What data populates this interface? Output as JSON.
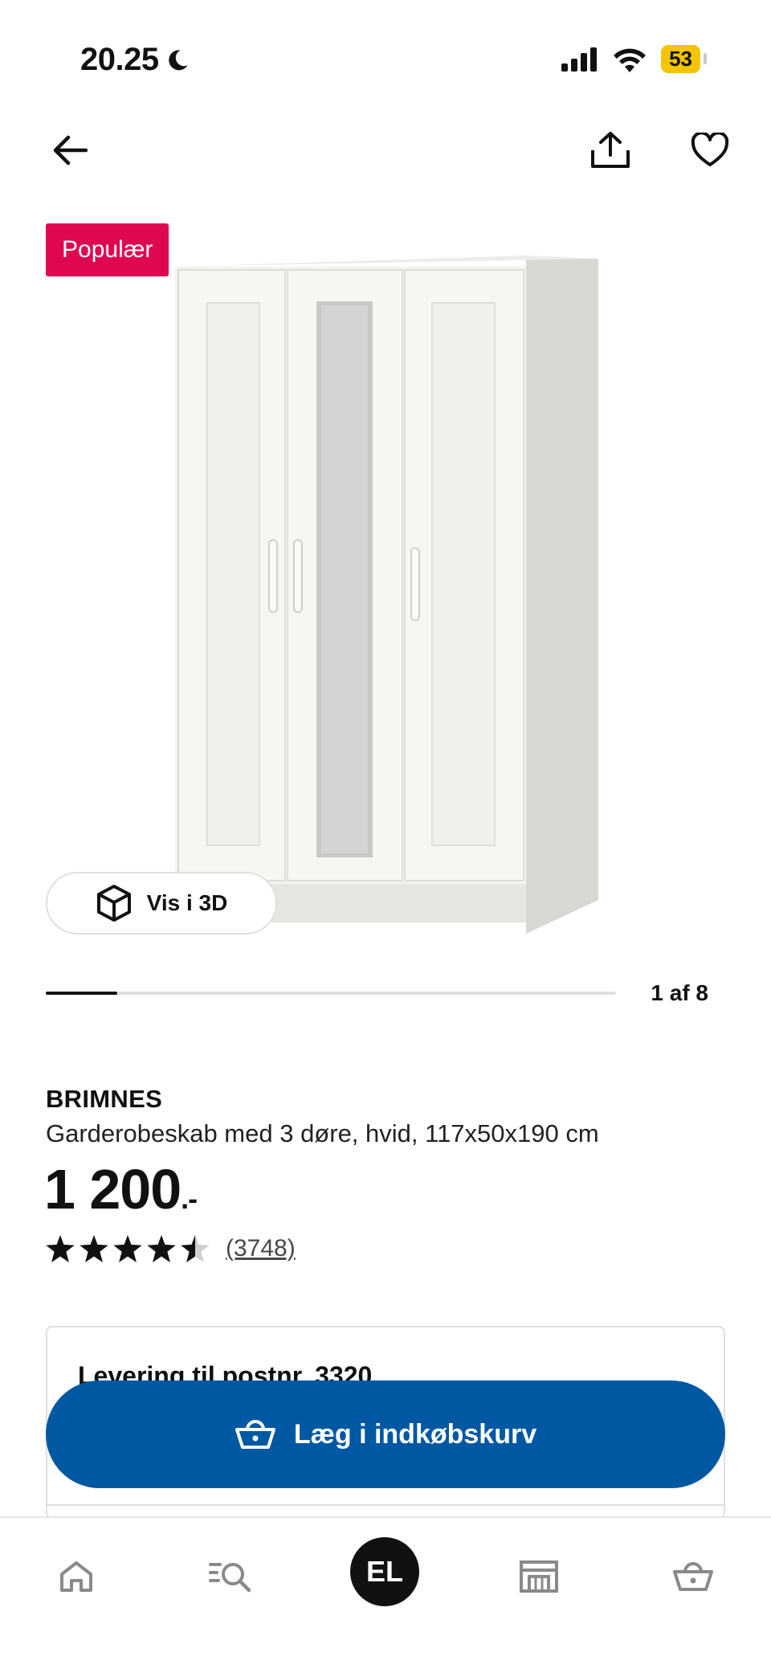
{
  "status_bar": {
    "time": "20.25",
    "battery": "53"
  },
  "colors": {
    "badge_bg": "#e00751",
    "cart_button_bg": "#0058a3",
    "battery_bg": "#f4c400",
    "text": "#111111"
  },
  "nav": {
    "back_icon": "arrow-left-icon",
    "share_icon": "share-icon",
    "favorite_icon": "heart-icon"
  },
  "gallery": {
    "badge": "Populær",
    "view_3d_label": "Vis i 3D",
    "position_label": "1 af 8",
    "current": 1,
    "total": 8
  },
  "product": {
    "name": "BRIMNES",
    "description": "Garderobeskab med 3 døre, hvid, 117x50x190 cm",
    "price": "1 200",
    "price_suffix": ".-",
    "rating": 4.5,
    "review_count": "(3748)"
  },
  "delivery": {
    "title": "Levering til postnr. 3320"
  },
  "cart_button": {
    "label": "Læg i indkøbskurv"
  },
  "tabbar": {
    "profile_initials": "EL",
    "items": [
      "home-icon",
      "search-icon",
      "profile-avatar",
      "store-icon",
      "basket-icon"
    ]
  }
}
